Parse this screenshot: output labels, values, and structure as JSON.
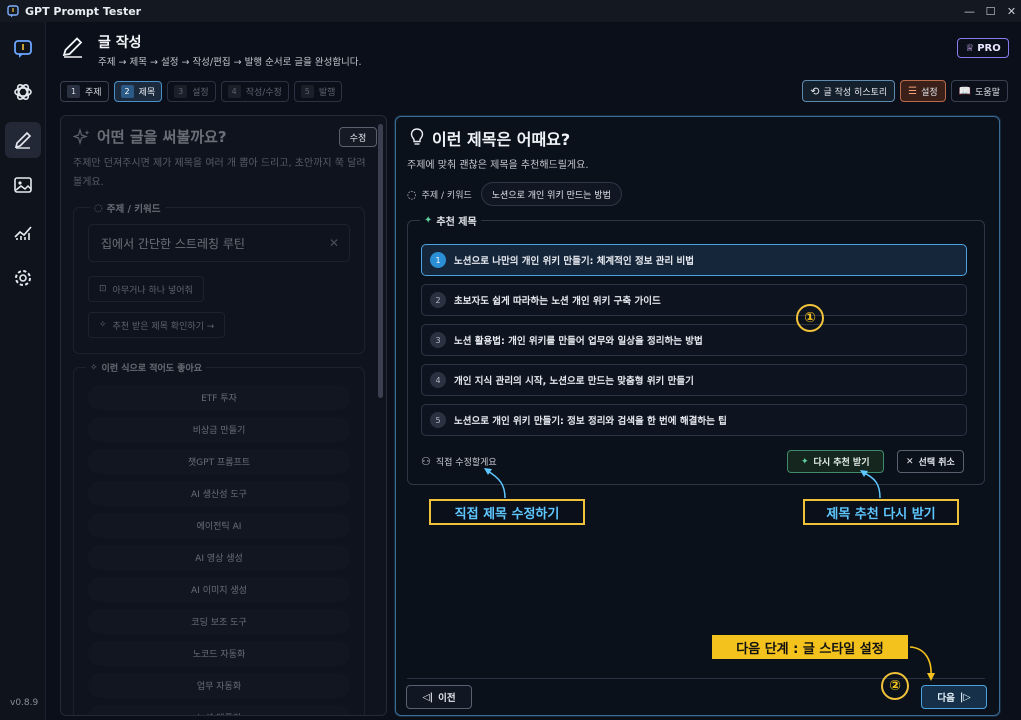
{
  "window": {
    "title": "GPT Prompt Tester"
  },
  "header": {
    "title": "글 작성",
    "subtitle": "주제 → 제목 → 설정 → 작성/편집 → 발행 순서로 글을 완성합니다.",
    "pro": "PRO"
  },
  "version": "v0.8.9",
  "steps": [
    {
      "num": "1",
      "label": "주제"
    },
    {
      "num": "2",
      "label": "제목"
    },
    {
      "num": "3",
      "label": "설정"
    },
    {
      "num": "4",
      "label": "작성/수정"
    },
    {
      "num": "5",
      "label": "발행"
    }
  ],
  "toolbar": {
    "history": "글 작성 히스토리",
    "settings": "설정",
    "help": "도움말"
  },
  "left": {
    "title": "어떤 글을 써볼까요?",
    "edit": "수정",
    "desc": "주제만 던져주시면 제가 제목을 여러 개 뽑아 드리고, 초안까지 쭉 달려볼게요.",
    "kw_legend": "주제 / 키워드",
    "kw_value": "집에서 간단한 스트레칭 루틴",
    "random_btn": "아무거나 하나 넣어줘",
    "check_btn": "추천 받은 제목 확인하기 →",
    "ex_legend": "이런 식으로 적어도 좋아요",
    "examples": [
      "ETF 투자",
      "비상금 만들기",
      "챗GPT 프롬프트",
      "AI 생산성 도구",
      "에이전틱 AI",
      "AI 영상 생성",
      "AI 이미지 생성",
      "코딩 보조 도구",
      "노코드 자동화",
      "업무 자동화",
      "노션 템플릿"
    ]
  },
  "right": {
    "title": "이런 제목은 어때요?",
    "desc": "주제에 맞춰 괜찮은 제목을 추천해드릴게요.",
    "topic_label": "주제 / 키워드",
    "topic_value": "노션으로 개인 위키 만드는 방법",
    "rec_legend": "추천 제목",
    "titles": [
      {
        "n": "1",
        "text": "노션으로 나만의 개인 위키 만들기: 체계적인 정보 관리 비법"
      },
      {
        "n": "2",
        "text": "초보자도 쉽게 따라하는 노션 개인 위키 구축 가이드"
      },
      {
        "n": "3",
        "text": "노션 활용법: 개인 위키를 만들어 업무와 일상을 정리하는 방법"
      },
      {
        "n": "4",
        "text": "개인 지식 관리의 시작, 노션으로 만드는 맞춤형 위키 만들기"
      },
      {
        "n": "5",
        "text": "노션으로 개인 위키 만들기: 정보 정리와 검색을 한 번에 해결하는 팁"
      }
    ],
    "direct": "직접 수정할게요",
    "regen": "다시 추천 받기",
    "cancel": "선택 취소",
    "prev": "이전",
    "next": "다음"
  },
  "annotations": {
    "c1": "①",
    "c2": "②",
    "direct_callout": "직접 제목 수정하기",
    "regen_callout": "제목 추천 다시 받기",
    "next_callout": "다음 단계 : 글 스타일 설정"
  },
  "colors": {
    "accent": "#4aa3e0",
    "annotation": "#f4c21d",
    "callout_text": "#5ec7ff"
  }
}
